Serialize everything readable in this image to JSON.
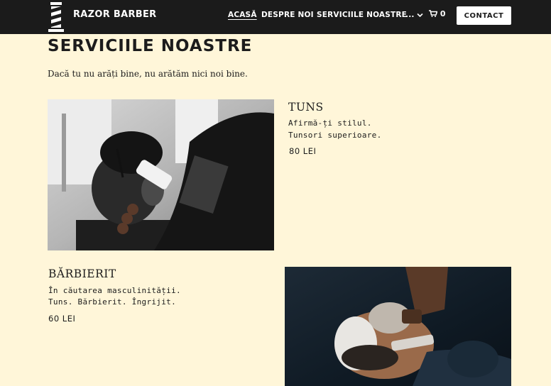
{
  "header": {
    "brand": "RAZOR BARBER",
    "nav": [
      {
        "label": "ACASĂ"
      },
      {
        "label": "DESPRE NOI"
      },
      {
        "label": "SERVICIILE NOASTRE"
      },
      {
        "label": "..."
      }
    ],
    "cart_count": "0",
    "contact_label": "CONTACT"
  },
  "main": {
    "title": "SERVICIILE NOASTRE",
    "subtitle": "Dacă tu nu arăți bine, nu arătăm nici noi bine.",
    "services": [
      {
        "name": "TUNS",
        "lines": [
          "Afirmă-ți stilul.",
          "Tunsori superioare."
        ],
        "price": "80 LEI"
      },
      {
        "name": "BĂRBIERIT",
        "lines": [
          "În căutarea masculinității.",
          "Tuns. Bărbierit. Îngrijit."
        ],
        "price": "60 LEI"
      }
    ]
  },
  "colors": {
    "header_bg": "#1b1b1b",
    "page_bg": "#fff6d9",
    "text": "#1c1c1c"
  }
}
